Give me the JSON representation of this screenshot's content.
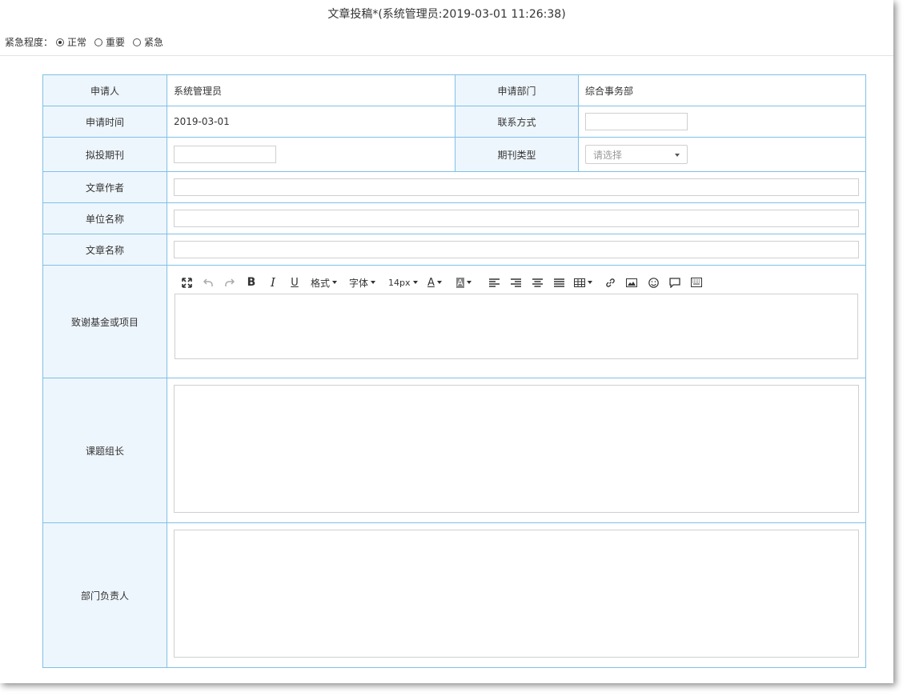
{
  "header": {
    "title": "文章投稿*(系统管理员:2019-03-01 11:26:38)"
  },
  "urgency": {
    "label": "紧急程度：",
    "options": [
      {
        "label": "正常",
        "checked": true
      },
      {
        "label": "重要",
        "checked": false
      },
      {
        "label": "紧急",
        "checked": false
      }
    ]
  },
  "form": {
    "applicant_label": "申请人",
    "applicant_value": "系统管理员",
    "department_label": "申请部门",
    "department_value": "综合事务部",
    "apply_time_label": "申请时间",
    "apply_time_value": "2019-03-01",
    "contact_label": "联系方式",
    "contact_value": "",
    "journal_label": "拟投期刊",
    "journal_value": "",
    "journal_type_label": "期刊类型",
    "journal_type_placeholder": "请选择",
    "author_label": "文章作者",
    "author_value": "",
    "unit_label": "单位名称",
    "unit_value": "",
    "article_label": "文章名称",
    "article_value": "",
    "fund_label": "致谢基金或项目",
    "leader_label": "课题组长",
    "dept_head_label": "部门负责人"
  },
  "editor": {
    "format_label": "格式",
    "font_label": "字体",
    "size_label": "14px",
    "font_color_label": "A",
    "bg_color_label": "A"
  },
  "icons": [
    "fullscreen-icon",
    "undo-icon",
    "redo-icon",
    "bold-icon",
    "italic-icon",
    "underline-icon",
    "align-left-icon",
    "align-right-icon",
    "align-center-icon",
    "align-justify-icon",
    "table-icon",
    "link-icon",
    "image-icon",
    "emoji-icon",
    "comment-icon",
    "keyboard-icon"
  ],
  "colors": {
    "border": "#7fc1e6",
    "label_bg": "#eef6fd"
  }
}
